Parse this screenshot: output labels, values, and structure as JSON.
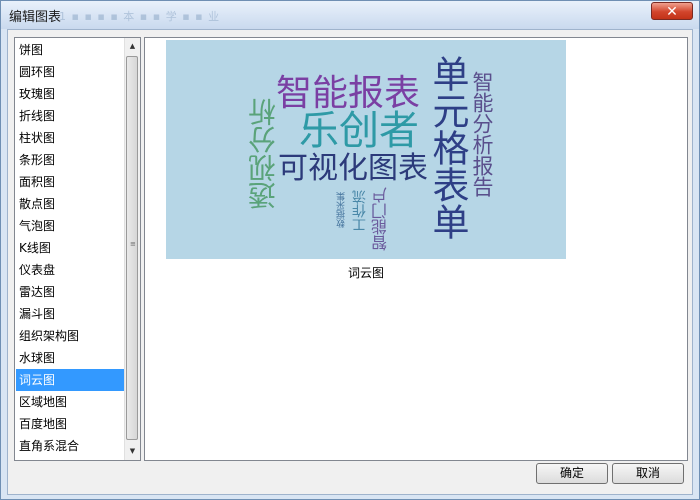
{
  "window": {
    "title": "编辑图表",
    "ghost_title": "1 ▪ ▪ ▪ ▪ 本 ▪ ▪ 学 ▪ ▪ 业"
  },
  "chart_types": [
    "饼图",
    "圆环图",
    "玫瑰图",
    "折线图",
    "柱状图",
    "条形图",
    "面积图",
    "散点图",
    "气泡图",
    "K线图",
    "仪表盘",
    "雷达图",
    "漏斗图",
    "组织架构图",
    "水球图",
    "词云图",
    "区域地图",
    "百度地图",
    "直角系混合"
  ],
  "selected_chart_type": "词云图",
  "preview": {
    "caption": "词云图",
    "words": [
      {
        "text": "智能报表",
        "color": "#7a3fa3"
      },
      {
        "text": "乐创者",
        "color": "#2e9aa6"
      },
      {
        "text": "可视化图表",
        "color": "#2c3a7a"
      },
      {
        "text": "单元格表单",
        "color": "#2e3f86"
      },
      {
        "text": "智能分析报告",
        "color": "#5a4f8c"
      },
      {
        "text": "透视分析",
        "color": "#5aa37a"
      },
      {
        "text": "工作流",
        "color": "#4a88a8"
      },
      {
        "text": "智能门户",
        "color": "#6a5a9c"
      },
      {
        "text": "数据采集",
        "color": "#4a78a0"
      }
    ],
    "background_color": "#a9cde0"
  },
  "buttons": {
    "ok": "确定",
    "cancel": "取消"
  }
}
